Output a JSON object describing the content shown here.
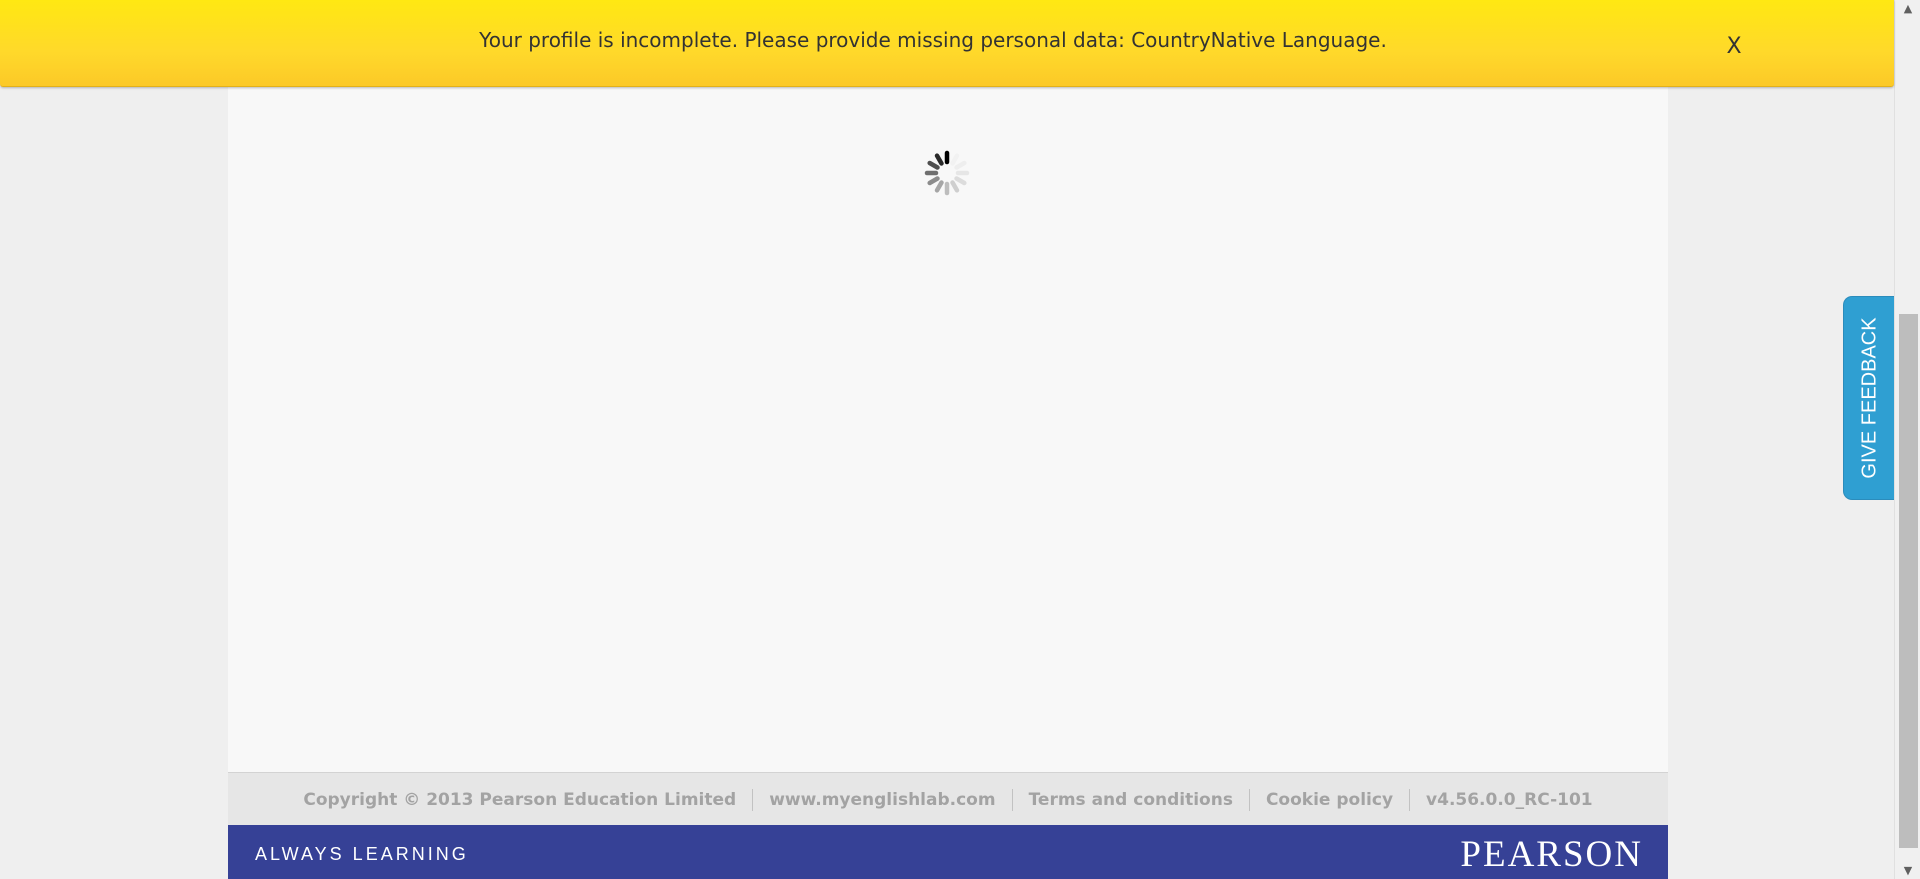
{
  "notification": {
    "message": "Your profile is incomplete. Please provide missing personal data: CountryNative Language.",
    "close_label": "X",
    "color": "#ffe812"
  },
  "main": {
    "loading": true
  },
  "footer": {
    "links": [
      "Copyright © 2013 Pearson Education Limited",
      "www.myenglishlab.com",
      "Terms and conditions",
      "Cookie policy",
      "v4.56.0.0_RC-101"
    ]
  },
  "brand": {
    "tagline": "ALWAYS LEARNING",
    "logo": "PEARSON",
    "color": "#364196"
  },
  "feedback": {
    "label": "GIVE FEEDBACK",
    "color": "#2f9fd2"
  },
  "scrollbar": {
    "up_icon": "up-arrow",
    "down_icon": "down-arrow"
  }
}
